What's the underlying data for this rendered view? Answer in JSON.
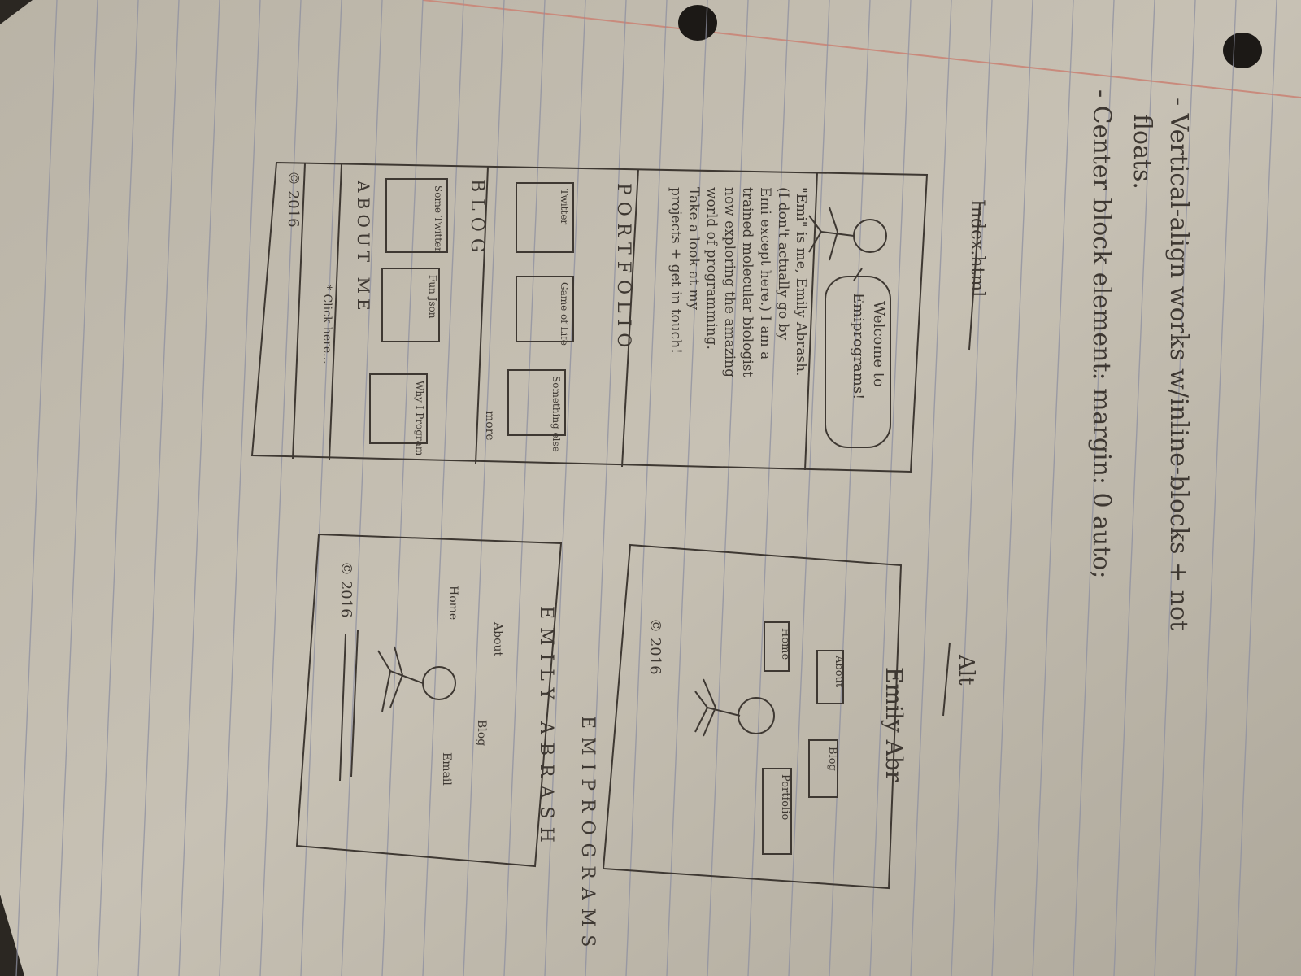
{
  "notes": {
    "line1": "- Vertical-align works w/inline-blocks + not",
    "line2": "floats.",
    "line3": "- Center block element: margin: 0 auto;"
  },
  "index_label": "Index.html",
  "alt_label": "Alt",
  "index_sketch": {
    "welcome": "Welcome to",
    "welcome2": "Emiprograms!",
    "bio": [
      "\"Emi\" is me, Emily Abrash.",
      "(I don't actually go by",
      "Emi except here.) I am a",
      "trained molecular biologist",
      "now exploring the amazing",
      "world of programming.",
      "Take a look at my",
      "projects + get in touch!"
    ],
    "portfolio_heading": "PORTFOLIO",
    "portfolio_cards": [
      "Twitter",
      "Game of Life",
      "Something else"
    ],
    "portfolio_more": "more",
    "blog_heading": "BLOG",
    "blog_cards": [
      "Some Twitter",
      "Fun Json",
      "Why I Program"
    ],
    "about_heading": "ABOUT ME",
    "about_link": "* Click here...",
    "footer": "© 2016"
  },
  "alt_sketch_1": {
    "name": "Emily Abr",
    "buttons": [
      "Home",
      "About",
      "Blog",
      "Portfolio"
    ],
    "footer": "© 2016"
  },
  "alt_sketch_2": {
    "title": "EMIPROGRAMS",
    "name": "EMILY ABRASH",
    "nav": [
      "Home",
      "About",
      "Blog",
      "Email"
    ],
    "footer": "© 2016"
  }
}
